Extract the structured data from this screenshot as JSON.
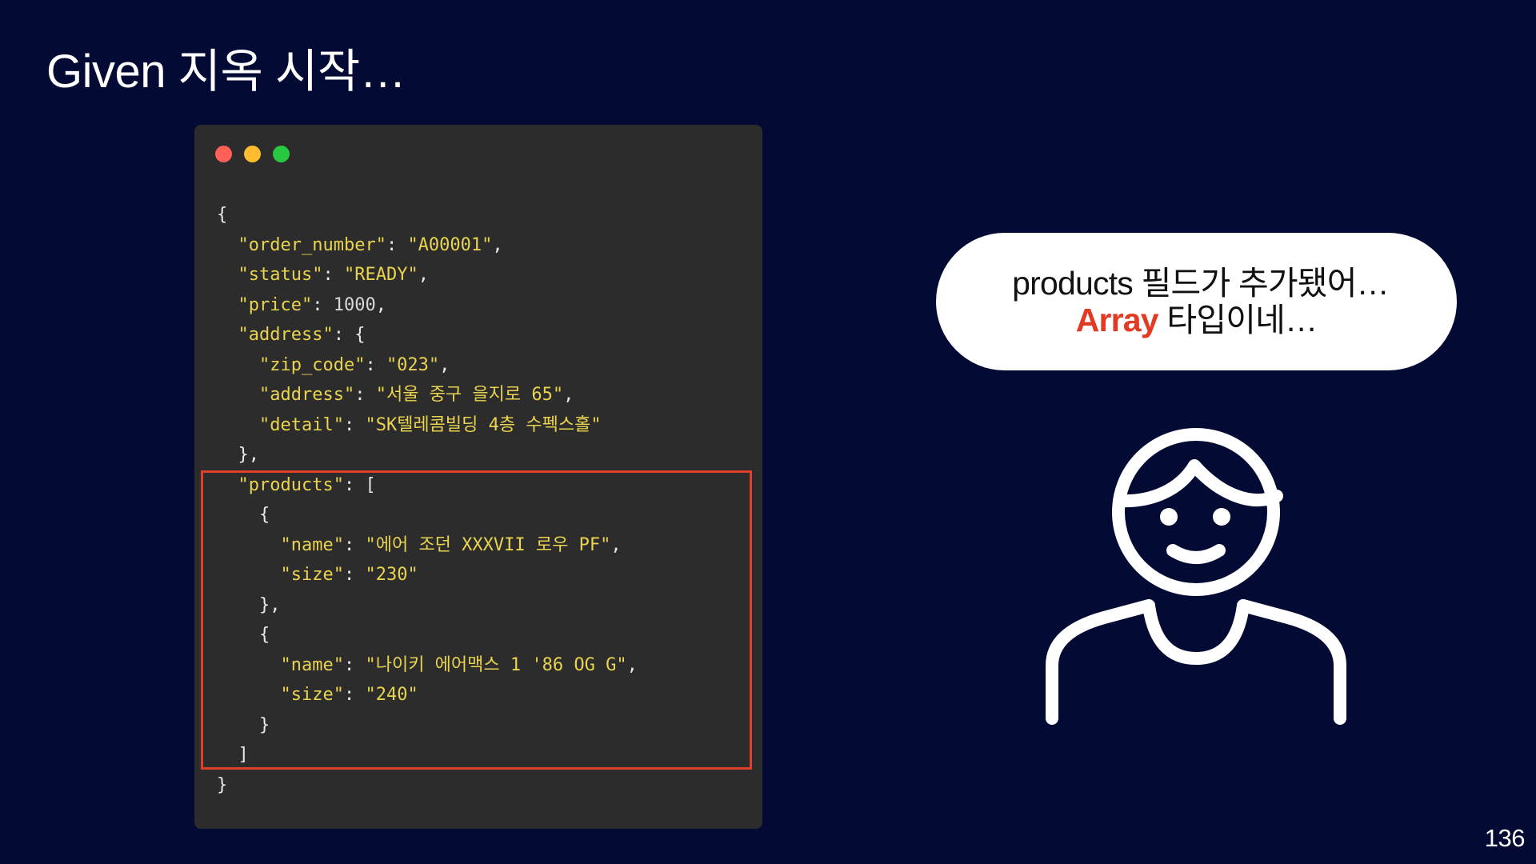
{
  "title": "Given 지옥 시작…",
  "code_window": {
    "traffic_lights": {
      "red": "#fe5f57",
      "yellow": "#febc2e",
      "green": "#28c840"
    },
    "lines": [
      [
        {
          "t": "p",
          "v": "{"
        }
      ],
      [
        {
          "t": "p",
          "v": "  "
        },
        {
          "t": "k",
          "v": "\"order_number\""
        },
        {
          "t": "p",
          "v": ": "
        },
        {
          "t": "s",
          "v": "\"A00001\""
        },
        {
          "t": "p",
          "v": ","
        }
      ],
      [
        {
          "t": "p",
          "v": "  "
        },
        {
          "t": "k",
          "v": "\"status\""
        },
        {
          "t": "p",
          "v": ": "
        },
        {
          "t": "s",
          "v": "\"READY\""
        },
        {
          "t": "p",
          "v": ","
        }
      ],
      [
        {
          "t": "p",
          "v": "  "
        },
        {
          "t": "k",
          "v": "\"price\""
        },
        {
          "t": "p",
          "v": ": "
        },
        {
          "t": "n",
          "v": "1000"
        },
        {
          "t": "p",
          "v": ","
        }
      ],
      [
        {
          "t": "p",
          "v": "  "
        },
        {
          "t": "k",
          "v": "\"address\""
        },
        {
          "t": "p",
          "v": ": {"
        }
      ],
      [
        {
          "t": "p",
          "v": "    "
        },
        {
          "t": "k",
          "v": "\"zip_code\""
        },
        {
          "t": "p",
          "v": ": "
        },
        {
          "t": "s",
          "v": "\"023\""
        },
        {
          "t": "p",
          "v": ","
        }
      ],
      [
        {
          "t": "p",
          "v": "    "
        },
        {
          "t": "k",
          "v": "\"address\""
        },
        {
          "t": "p",
          "v": ": "
        },
        {
          "t": "s",
          "v": "\"서울 중구 을지로 65\""
        },
        {
          "t": "p",
          "v": ","
        }
      ],
      [
        {
          "t": "p",
          "v": "    "
        },
        {
          "t": "k",
          "v": "\"detail\""
        },
        {
          "t": "p",
          "v": ": "
        },
        {
          "t": "s",
          "v": "\"SK텔레콤빌딩 4층 수펙스홀\""
        }
      ],
      [
        {
          "t": "p",
          "v": "  },"
        }
      ],
      [
        {
          "t": "p",
          "v": "  "
        },
        {
          "t": "k",
          "v": "\"products\""
        },
        {
          "t": "p",
          "v": ": ["
        }
      ],
      [
        {
          "t": "p",
          "v": "    {"
        }
      ],
      [
        {
          "t": "p",
          "v": "      "
        },
        {
          "t": "k",
          "v": "\"name\""
        },
        {
          "t": "p",
          "v": ": "
        },
        {
          "t": "s",
          "v": "\"에어 조던 XXXVII 로우 PF\""
        },
        {
          "t": "p",
          "v": ","
        }
      ],
      [
        {
          "t": "p",
          "v": "      "
        },
        {
          "t": "k",
          "v": "\"size\""
        },
        {
          "t": "p",
          "v": ": "
        },
        {
          "t": "s",
          "v": "\"230\""
        }
      ],
      [
        {
          "t": "p",
          "v": "    },"
        }
      ],
      [
        {
          "t": "p",
          "v": "    {"
        }
      ],
      [
        {
          "t": "p",
          "v": "      "
        },
        {
          "t": "k",
          "v": "\"name\""
        },
        {
          "t": "p",
          "v": ": "
        },
        {
          "t": "s",
          "v": "\"나이키 에어맥스 1 '86 OG G\""
        },
        {
          "t": "p",
          "v": ","
        }
      ],
      [
        {
          "t": "p",
          "v": "      "
        },
        {
          "t": "k",
          "v": "\"size\""
        },
        {
          "t": "p",
          "v": ": "
        },
        {
          "t": "s",
          "v": "\"240\""
        }
      ],
      [
        {
          "t": "p",
          "v": "    }"
        }
      ],
      [
        {
          "t": "p",
          "v": "  ]"
        }
      ],
      [
        {
          "t": "p",
          "v": "}"
        }
      ]
    ]
  },
  "highlight_color": "#e0402a",
  "speech_bubble": {
    "line1": "products 필드가 추가됐어…",
    "line2_accent": "Array",
    "line2_rest": " 타입이네…",
    "accent_color": "#e33a24"
  },
  "person_icon": "person-outline-icon",
  "page_number": "136"
}
